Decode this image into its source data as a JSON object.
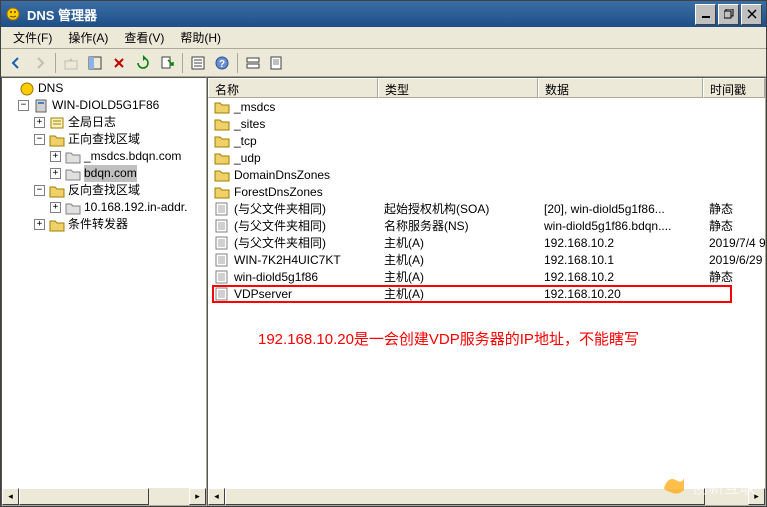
{
  "window": {
    "title": "DNS 管理器",
    "min": "_",
    "restore": "❐",
    "close": "✕"
  },
  "menu": {
    "file": "文件(F)",
    "action": "操作(A)",
    "view": "查看(V)",
    "help": "帮助(H)"
  },
  "tree": {
    "root": "DNS",
    "server": "WIN-DIOLD5G1F86",
    "global_log": "全局日志",
    "forward_zone": "正向查找区域",
    "msdcs": "_msdcs.bdqn.com",
    "bdqn": "bdqn.com",
    "reverse_zone": "反向查找区域",
    "reverse_ip": "10.168.192.in-addr.",
    "conditional": "条件转发器"
  },
  "columns": {
    "name": "名称",
    "type": "类型",
    "data": "数据",
    "timestamp": "时间戳"
  },
  "col_widths": {
    "name": 170,
    "type": 160,
    "data": 165,
    "timestamp": 62
  },
  "rows": [
    {
      "icon": "folder",
      "name": "_msdcs",
      "type": "",
      "data": "",
      "ts": ""
    },
    {
      "icon": "folder",
      "name": "_sites",
      "type": "",
      "data": "",
      "ts": ""
    },
    {
      "icon": "folder",
      "name": "_tcp",
      "type": "",
      "data": "",
      "ts": ""
    },
    {
      "icon": "folder",
      "name": "_udp",
      "type": "",
      "data": "",
      "ts": ""
    },
    {
      "icon": "folder",
      "name": "DomainDnsZones",
      "type": "",
      "data": "",
      "ts": ""
    },
    {
      "icon": "folder",
      "name": "ForestDnsZones",
      "type": "",
      "data": "",
      "ts": ""
    },
    {
      "icon": "record",
      "name": "(与父文件夹相同)",
      "type": "起始授权机构(SOA)",
      "data": "[20], win-diold5g1f86...",
      "ts": "静态"
    },
    {
      "icon": "record",
      "name": "(与父文件夹相同)",
      "type": "名称服务器(NS)",
      "data": "win-diold5g1f86.bdqn....",
      "ts": "静态"
    },
    {
      "icon": "record",
      "name": "(与父文件夹相同)",
      "type": "主机(A)",
      "data": "192.168.10.2",
      "ts": "2019/7/4 9"
    },
    {
      "icon": "record",
      "name": "WIN-7K2H4UIC7KT",
      "type": "主机(A)",
      "data": "192.168.10.1",
      "ts": "2019/6/29"
    },
    {
      "icon": "record",
      "name": "win-diold5g1f86",
      "type": "主机(A)",
      "data": "192.168.10.2",
      "ts": "静态"
    },
    {
      "icon": "record",
      "name": "VDPserver",
      "type": "主机(A)",
      "data": "192.168.10.20",
      "ts": ""
    }
  ],
  "annotation": "192.168.10.20是一会创建VDP服务器的IP地址，不能瞎写",
  "watermark": "创新互联"
}
